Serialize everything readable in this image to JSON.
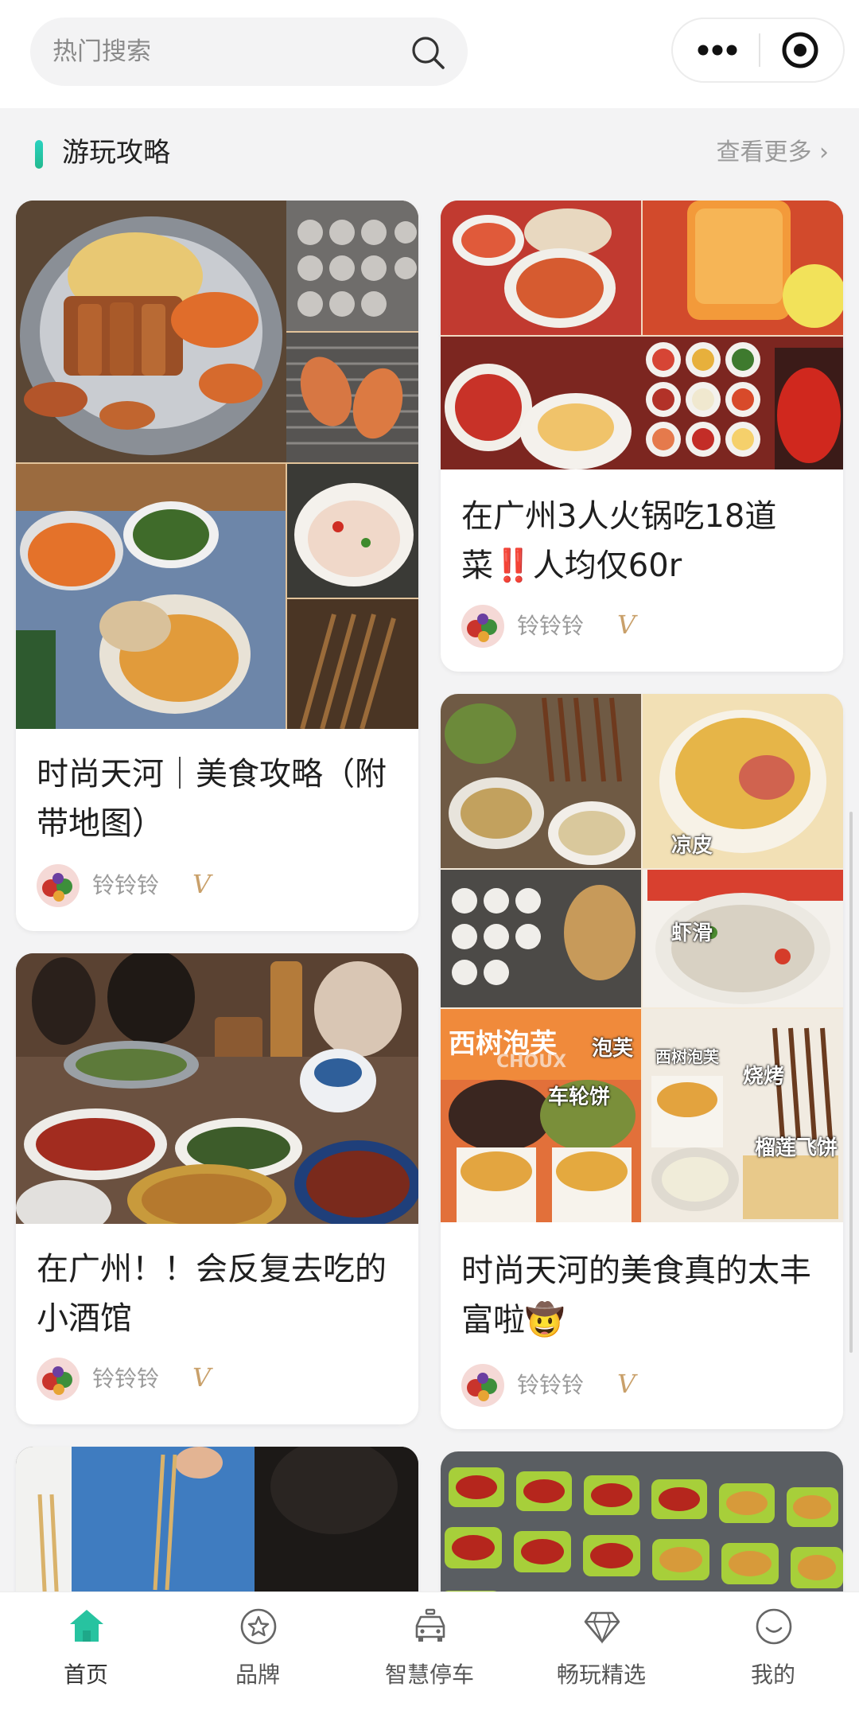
{
  "search": {
    "placeholder": "热门搜索"
  },
  "section": {
    "title": "游玩攻略",
    "more_label": "查看更多 ›"
  },
  "cards": [
    {
      "title": "时尚天河｜美食攻略（附带地图）",
      "author": "铃铃铃",
      "badge": "V"
    },
    {
      "title": "在广州3人火锅吃18道菜‼️人均仅60r",
      "author": "铃铃铃",
      "badge": "V"
    },
    {
      "title": "在广州！！会反复去吃的小酒馆",
      "author": "铃铃铃",
      "badge": "V"
    },
    {
      "title": "时尚天河的美食真的太丰富啦🤠",
      "author": "铃铃铃",
      "badge": "V",
      "image_labels": [
        "西树泡芙",
        "凉皮",
        "虾滑",
        "西树泡芙",
        "泡芙",
        "车轮饼",
        "烧烤",
        "榴莲飞饼"
      ],
      "brand_sub": "CHOUX"
    }
  ],
  "nav": {
    "items": [
      {
        "label": "首页",
        "icon": "home-icon",
        "active": true
      },
      {
        "label": "品牌",
        "icon": "brand-star-icon",
        "active": false
      },
      {
        "label": "智慧停车",
        "icon": "parking-car-icon",
        "active": false
      },
      {
        "label": "畅玩精选",
        "icon": "diamond-icon",
        "active": false
      },
      {
        "label": "我的",
        "icon": "smile-icon",
        "active": false
      }
    ]
  },
  "colors": {
    "accent": "#27c3a0",
    "verified": "#c9a06a",
    "muted_text": "#9a9a9a"
  }
}
